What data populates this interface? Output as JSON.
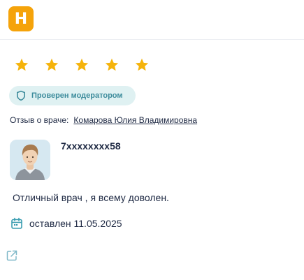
{
  "header": {
    "logo_letter": "Н"
  },
  "rating": {
    "value": 5,
    "max": 5,
    "color": "#f5b30b"
  },
  "badge": {
    "text": "Проверен модератором",
    "icon": "shield-icon"
  },
  "doctor": {
    "label": "Отзыв о враче:",
    "name": "Комарова Юлия Владимировна"
  },
  "user": {
    "name": "7xxxxxxxx58",
    "avatar": "avatar-icon"
  },
  "review": {
    "text": "Отличный врач , я всему доволен."
  },
  "date": {
    "text": "оставлен 11.05.2025",
    "icon": "calendar-icon"
  },
  "actions": {
    "external_icon": "external-link-icon"
  },
  "colors": {
    "brand": "#f5a30a",
    "badge_bg": "#dff1f2",
    "badge_text": "#3d8c9c",
    "text": "#1f2a44",
    "icon_teal": "#3a9db0"
  }
}
